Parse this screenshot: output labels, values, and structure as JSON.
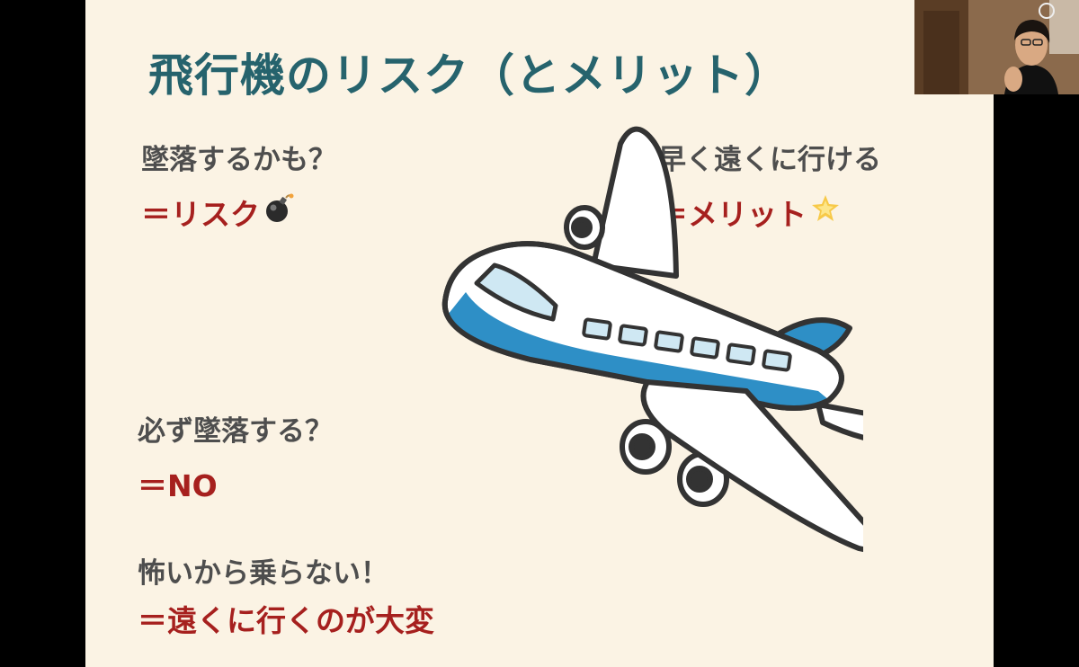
{
  "slide": {
    "title": "飛行機のリスク（とメリット）",
    "q1": "墜落するかも？",
    "a1": "＝リスク",
    "a1_icon": "bomb-icon",
    "q2": "早く遠くに行ける",
    "a2": "＝メリット",
    "a2_icon": "sparkle-star-icon",
    "q3": "必ず墜落する？",
    "a3": "＝NO",
    "q4": "怖いから乗らない！",
    "a4": "＝遠くに行くのが大変"
  },
  "colors": {
    "background": "#fbf3e4",
    "title": "#26636d",
    "question": "#4e4e4e",
    "answer": "#a6201e",
    "plane_blue": "#2e8fc6",
    "window_blue": "#cfe8f3"
  },
  "webcam": {
    "content": "presenter-video"
  }
}
